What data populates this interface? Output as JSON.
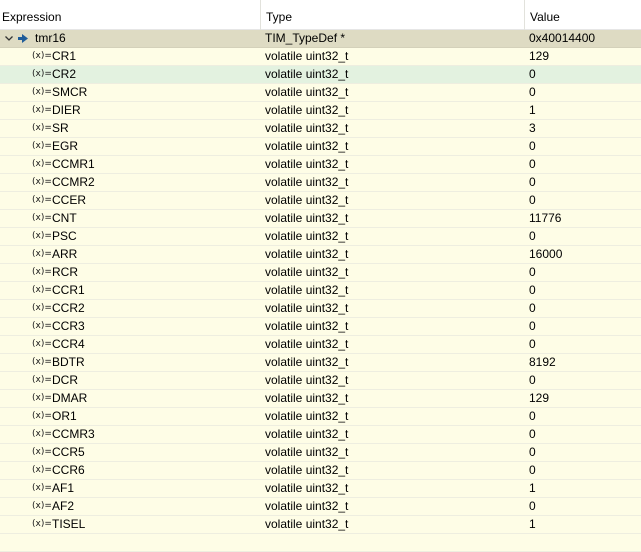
{
  "columns": {
    "expression": "Expression",
    "type": "Type",
    "value": "Value"
  },
  "parent": {
    "name": "tmr16",
    "type": "TIM_TypeDef *",
    "value": "0x40014400"
  },
  "var_icon": "(x)=",
  "icons": {
    "expand": "chevron-down-icon",
    "pointer": "pointer-arrow-icon",
    "variable": "variable-icon"
  },
  "selected_row": "CR2",
  "fields": [
    {
      "name": "CR1",
      "type": "volatile uint32_t",
      "value": "129"
    },
    {
      "name": "CR2",
      "type": "volatile uint32_t",
      "value": "0"
    },
    {
      "name": "SMCR",
      "type": "volatile uint32_t",
      "value": "0"
    },
    {
      "name": "DIER",
      "type": "volatile uint32_t",
      "value": "1"
    },
    {
      "name": "SR",
      "type": "volatile uint32_t",
      "value": "3"
    },
    {
      "name": "EGR",
      "type": "volatile uint32_t",
      "value": "0"
    },
    {
      "name": "CCMR1",
      "type": "volatile uint32_t",
      "value": "0"
    },
    {
      "name": "CCMR2",
      "type": "volatile uint32_t",
      "value": "0"
    },
    {
      "name": "CCER",
      "type": "volatile uint32_t",
      "value": "0"
    },
    {
      "name": "CNT",
      "type": "volatile uint32_t",
      "value": "11776"
    },
    {
      "name": "PSC",
      "type": "volatile uint32_t",
      "value": "0"
    },
    {
      "name": "ARR",
      "type": "volatile uint32_t",
      "value": "16000"
    },
    {
      "name": "RCR",
      "type": "volatile uint32_t",
      "value": "0"
    },
    {
      "name": "CCR1",
      "type": "volatile uint32_t",
      "value": "0"
    },
    {
      "name": "CCR2",
      "type": "volatile uint32_t",
      "value": "0"
    },
    {
      "name": "CCR3",
      "type": "volatile uint32_t",
      "value": "0"
    },
    {
      "name": "CCR4",
      "type": "volatile uint32_t",
      "value": "0"
    },
    {
      "name": "BDTR",
      "type": "volatile uint32_t",
      "value": "8192"
    },
    {
      "name": "DCR",
      "type": "volatile uint32_t",
      "value": "0"
    },
    {
      "name": "DMAR",
      "type": "volatile uint32_t",
      "value": "129"
    },
    {
      "name": "OR1",
      "type": "volatile uint32_t",
      "value": "0"
    },
    {
      "name": "CCMR3",
      "type": "volatile uint32_t",
      "value": "0"
    },
    {
      "name": "CCR5",
      "type": "volatile uint32_t",
      "value": "0"
    },
    {
      "name": "CCR6",
      "type": "volatile uint32_t",
      "value": "0"
    },
    {
      "name": "AF1",
      "type": "volatile uint32_t",
      "value": "1"
    },
    {
      "name": "AF2",
      "type": "volatile uint32_t",
      "value": "0"
    },
    {
      "name": "TISEL",
      "type": "volatile uint32_t",
      "value": "1"
    }
  ]
}
